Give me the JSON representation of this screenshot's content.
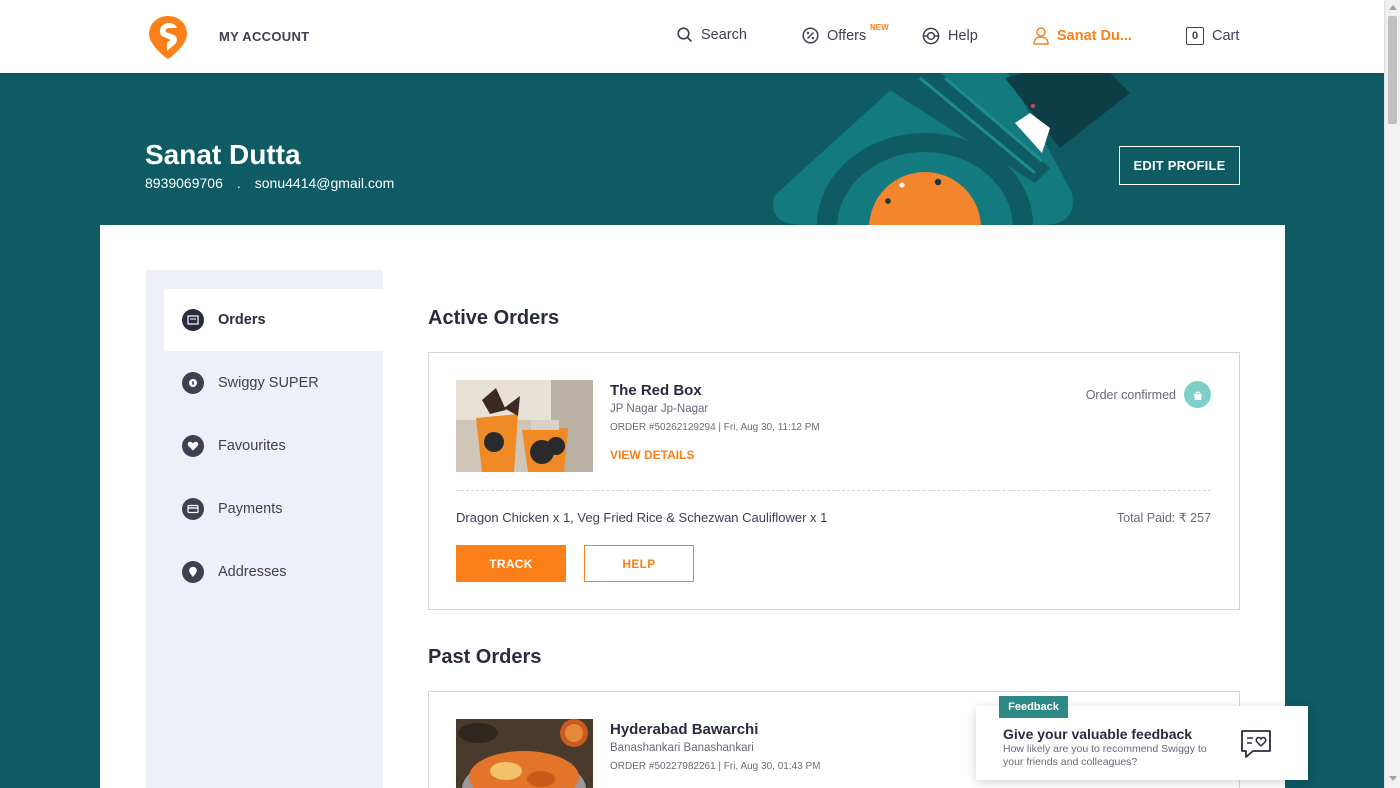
{
  "header": {
    "title": "MY ACCOUNT",
    "nav": {
      "search": "Search",
      "offers": "Offers",
      "offers_badge": "NEW",
      "help": "Help",
      "user": "Sanat Du...",
      "cart": "Cart",
      "cart_count": "0"
    }
  },
  "profile": {
    "name": "Sanat Dutta",
    "phone": "8939069706",
    "separator": ".",
    "email": "sonu4414@gmail.com",
    "edit_label": "EDIT PROFILE"
  },
  "sidebar": {
    "items": [
      {
        "label": "Orders",
        "icon": "orders-icon",
        "active": true
      },
      {
        "label": "Swiggy SUPER",
        "icon": "super-icon",
        "active": false
      },
      {
        "label": "Favourites",
        "icon": "heart-icon",
        "active": false
      },
      {
        "label": "Payments",
        "icon": "card-icon",
        "active": false
      },
      {
        "label": "Addresses",
        "icon": "location-icon",
        "active": false
      }
    ]
  },
  "active_orders": {
    "title": "Active Orders",
    "orders": [
      {
        "restaurant": "The Red Box",
        "area": "JP Nagar Jp-Nagar",
        "order_info": "ORDER #50262129294 | Fri, Aug 30, 11:12 PM",
        "view_details": "VIEW DETAILS",
        "status": "Order confirmed",
        "items": "Dragon Chicken x 1, Veg Fried Rice & Schezwan Cauliflower x 1",
        "total": "Total Paid: ₹ 257",
        "track_label": "TRACK",
        "help_label": "HELP"
      }
    ]
  },
  "past_orders": {
    "title": "Past Orders",
    "orders": [
      {
        "restaurant": "Hyderabad Bawarchi",
        "area": "Banashankari Banashankari",
        "order_info": "ORDER #50227982261 | Fri, Aug 30, 01:43 PM"
      }
    ]
  },
  "feedback": {
    "tag": "Feedback",
    "title": "Give your valuable feedback",
    "subtitle": "How likely are you to recommend Swiggy to your friends and colleagues?"
  },
  "colors": {
    "brand_orange": "#fc8019",
    "banner_teal": "#0e5b63",
    "status_green": "#60b246"
  }
}
